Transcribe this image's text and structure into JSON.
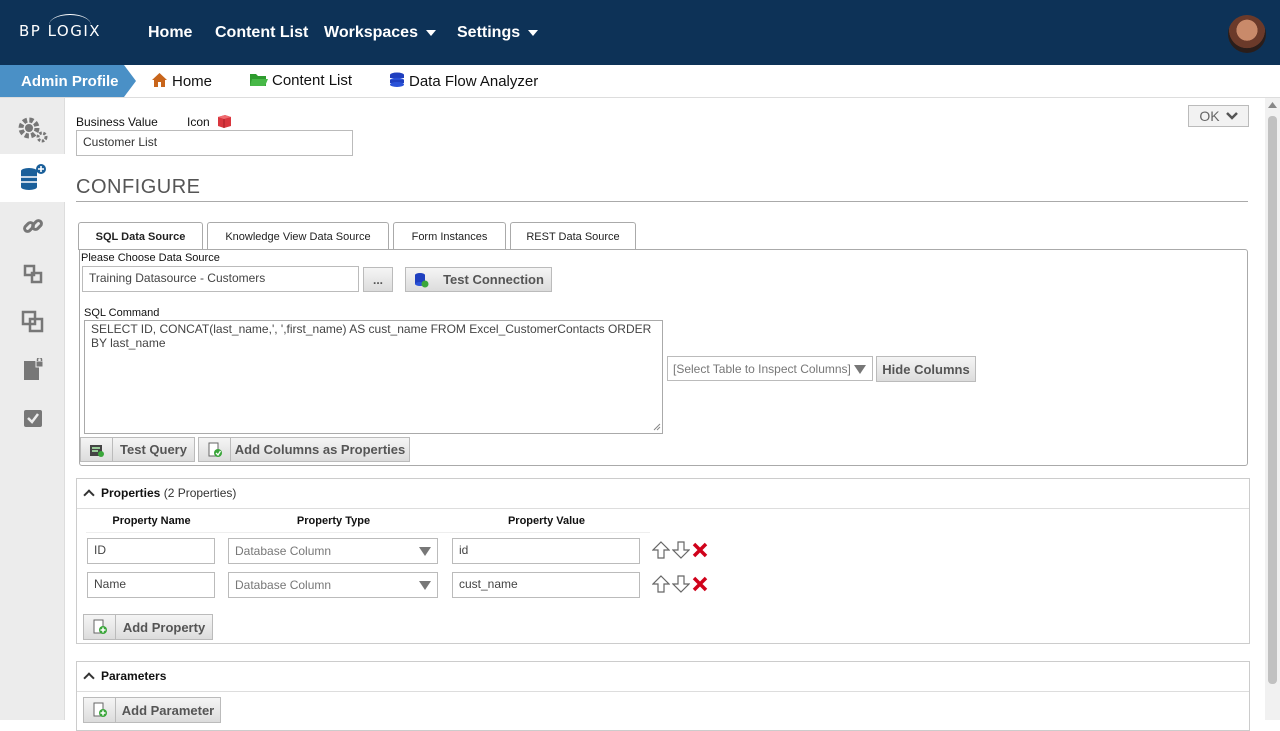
{
  "topbar": {
    "logo": "BP LOGIX",
    "nav": [
      "Home",
      "Content List",
      "Workspaces",
      "Settings"
    ]
  },
  "breadcrumb": {
    "admin_profile": "Admin Profile",
    "items": [
      "Home",
      "Content List",
      "Data Flow Analyzer"
    ]
  },
  "ok_button": "OK",
  "form": {
    "business_value_label": "Business Value",
    "icon_label": "Icon",
    "business_value": "Customer List",
    "configure_title": "CONFIGURE"
  },
  "tabs": [
    "SQL Data Source",
    "Knowledge View Data Source",
    "Form Instances",
    "REST Data Source"
  ],
  "sql": {
    "choose_label": "Please Choose Data Source",
    "datasource": "Training Datasource - Customers",
    "browse_label": "...",
    "test_connection": "Test Connection",
    "command_label": "SQL Command",
    "command": "SELECT ID, CONCAT(last_name,', ',first_name) AS cust_name  FROM Excel_CustomerContacts ORDER BY last_name",
    "inspect_placeholder": "[Select Table to Inspect Columns]",
    "hide_columns": "Hide Columns",
    "test_query": "Test Query",
    "add_columns": "Add Columns as Properties"
  },
  "properties": {
    "title": "Properties",
    "count": "(2 Properties)",
    "headers": [
      "Property Name",
      "Property Type",
      "Property Value"
    ],
    "rows": [
      {
        "name": "ID",
        "type": "Database Column",
        "value": "id"
      },
      {
        "name": "Name",
        "type": "Database Column",
        "value": "cust_name"
      }
    ],
    "add_property": "Add Property"
  },
  "parameters": {
    "title": "Parameters",
    "add_parameter": "Add Parameter"
  },
  "colors": {
    "topbar": "#0d3257",
    "accent": "#4a90c6",
    "delete": "#d0021b"
  }
}
